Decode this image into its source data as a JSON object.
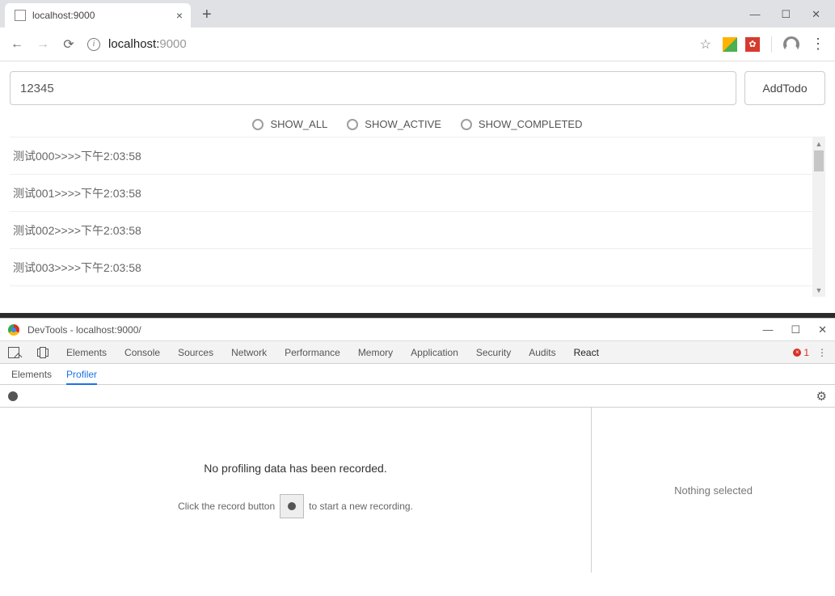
{
  "browser": {
    "tab_title": "localhost:9000",
    "url_host": "localhost:",
    "url_port": "9000"
  },
  "app": {
    "input_value": "12345",
    "add_button": "AddTodo",
    "filters": [
      "SHOW_ALL",
      "SHOW_ACTIVE",
      "SHOW_COMPLETED"
    ],
    "todos": [
      "测试000>>>>下午2:03:58",
      "测试001>>>>下午2:03:58",
      "测试002>>>>下午2:03:58",
      "测试003>>>>下午2:03:58"
    ]
  },
  "devtools": {
    "title": "DevTools - localhost:9000/",
    "tabs": [
      "Elements",
      "Console",
      "Sources",
      "Network",
      "Performance",
      "Memory",
      "Application",
      "Security",
      "Audits",
      "React"
    ],
    "error_count": "1",
    "subtabs": {
      "elements": "Elements",
      "profiler": "Profiler"
    },
    "profiler": {
      "msg1": "No profiling data has been recorded.",
      "msg2_a": "Click the record button",
      "msg2_b": "to start a new recording."
    },
    "right_panel": "Nothing selected"
  }
}
